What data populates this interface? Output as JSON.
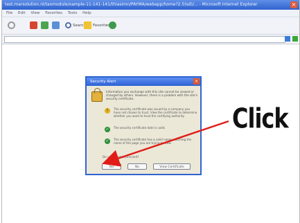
{
  "browser": {
    "title": "test.marsolution.nl/taxmodule/xample-11-141-141/thiasimn/PAYMA/webapp/home?2.5(sd)/... - Microsoft Internet Explorer",
    "menu": [
      "File",
      "Edit",
      "View",
      "Favorites",
      "Tools",
      "Help"
    ],
    "toolbar": {
      "search_label": "Search",
      "favorites_label": "Favorites"
    }
  },
  "dialog": {
    "title": "Security Alert",
    "intro": "Information you exchange with this site cannot be viewed or changed by others. However, there is a problem with the site's security certificate.",
    "items": [
      "The security certificate was issued by a company you have not chosen to trust. View the certificate to determine whether you want to trust the certifying authority.",
      "The security certificate date is valid.",
      "The security certificate has a valid name matching the name of the page you are trying to view."
    ],
    "question": "Do you want to proceed?",
    "buttons": {
      "yes": "Yes",
      "no": "No",
      "view": "View Certificate"
    }
  },
  "annotation": {
    "text": "Click",
    "color": "#e11d17"
  }
}
